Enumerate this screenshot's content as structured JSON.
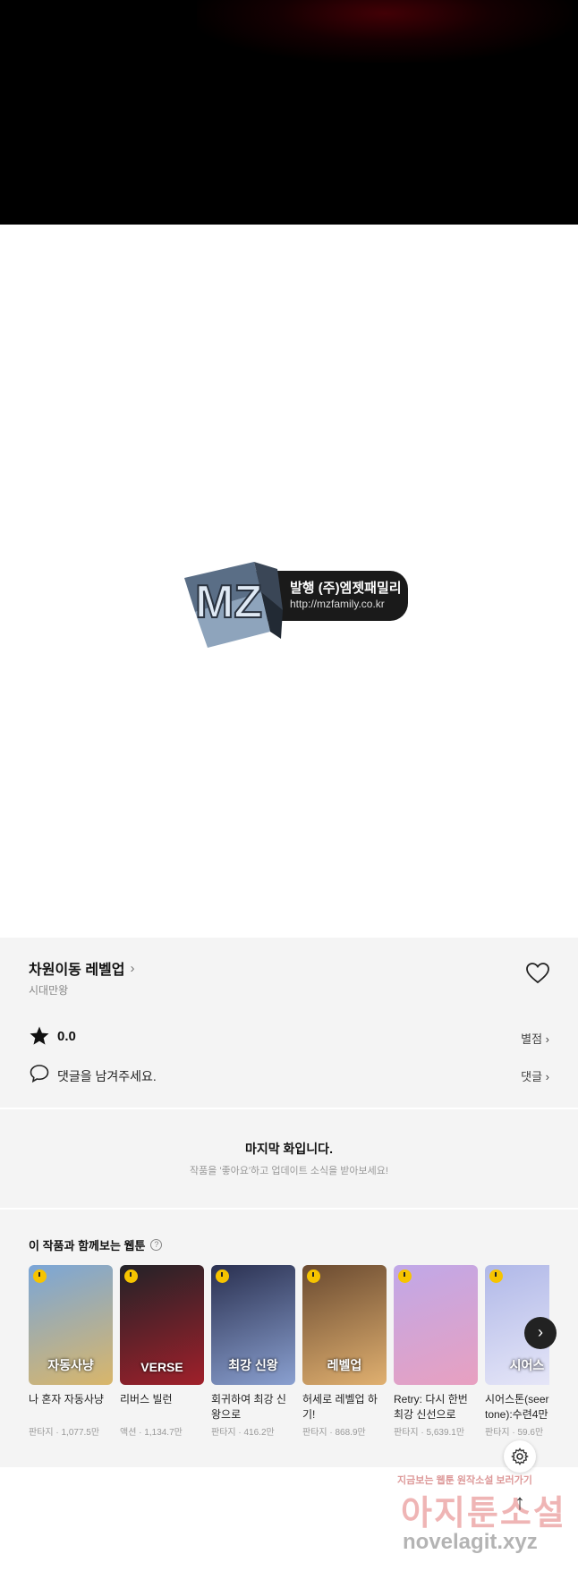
{
  "publisher": {
    "logo_text": "MZ",
    "label": "발행 (주)엠젯패밀리",
    "url": "http://mzfamily.co.kr"
  },
  "info": {
    "title": "차원이동 레벨업",
    "author": "시대만왕",
    "rating": "0.0",
    "rating_link": "별점",
    "comment_prompt": "댓글을 남겨주세요.",
    "comment_link": "댓글"
  },
  "last_episode": {
    "heading": "마지막 화입니다.",
    "subtext": "작품을 '좋아요'하고 업데이트 소식을 받아보세요!"
  },
  "recommendations": {
    "heading": "이 작품과 함께보는 웹툰",
    "help_icon": "?",
    "items": [
      {
        "cover_text": "자동사냥",
        "name": "나 혼자 자동사냥",
        "meta": "판타지 · 1,077.5만",
        "colors": [
          "#7aa6d8",
          "#d9b66a"
        ]
      },
      {
        "cover_text": "VERSE",
        "name": "리버스 빌런",
        "meta": "액션 · 1,134.7만",
        "colors": [
          "#222228",
          "#a0202a"
        ]
      },
      {
        "cover_text": "최강 신왕",
        "name": "회귀하여 최강 신왕으로",
        "meta": "판타지 · 416.2만",
        "colors": [
          "#2a3050",
          "#8aa0d0"
        ]
      },
      {
        "cover_text": "레벨업",
        "name": "허세로 레벨업 하기!",
        "meta": "판타지 · 868.9만",
        "colors": [
          "#6a4a30",
          "#e0b070"
        ]
      },
      {
        "cover_text": "",
        "name": "Retry: 다시 한번 최강 신선으로",
        "meta": "판타지 · 5,639.1만",
        "colors": [
          "#c0a8e8",
          "#e8a0c0"
        ]
      },
      {
        "cover_text": "시어스",
        "name": "시어스톤(seer tone):수련4만",
        "meta": "판타지 · 59.6만",
        "colors": [
          "#b0b8e8",
          "#e8e8f8"
        ]
      }
    ]
  },
  "watermark": {
    "line1": "지금보는 웹툰 원작소설 보러가기",
    "line2": "아지툰소설",
    "line3": "novelagit.xyz"
  },
  "colors": {
    "section_bg": "#f4f4f4",
    "hero_bg": "#000000",
    "accent_red": "#780010"
  }
}
